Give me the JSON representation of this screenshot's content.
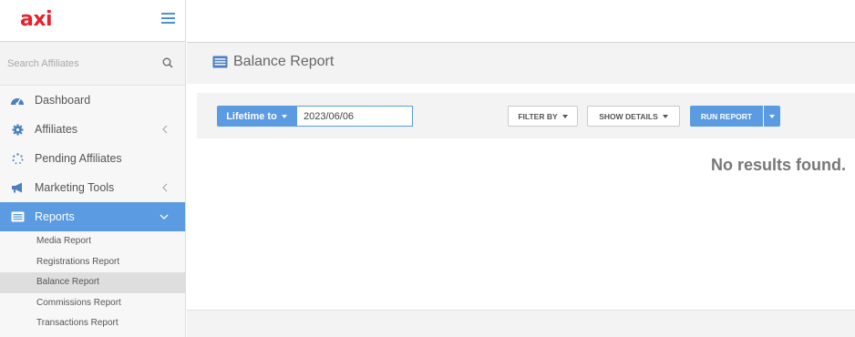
{
  "brand": {
    "logo_text": "axi",
    "logo_color": "#e8202a"
  },
  "sidebar": {
    "search_placeholder": "Search Affiliates",
    "items": [
      {
        "label": "Dashboard",
        "icon": "dashboard-gauge-icon"
      },
      {
        "label": "Affiliates",
        "icon": "gear-icon",
        "chevron": "left"
      },
      {
        "label": "Pending Affiliates",
        "icon": "spinner-dots-icon"
      },
      {
        "label": "Marketing Tools",
        "icon": "megaphone-icon",
        "chevron": "left"
      },
      {
        "label": "Reports",
        "icon": "report-list-icon",
        "chevron": "down",
        "active": true
      }
    ],
    "sub_items": [
      {
        "label": "Media Report"
      },
      {
        "label": "Registrations Report"
      },
      {
        "label": "Balance Report",
        "active": true
      },
      {
        "label": "Commissions Report"
      },
      {
        "label": "Transactions Report"
      }
    ]
  },
  "page": {
    "title": "Balance Report",
    "title_icon": "report-list-icon"
  },
  "toolbar": {
    "lifetime_label": "Lifetime to",
    "date_value": "2023/06/06",
    "filter_by_label": "FILTER BY",
    "show_details_label": "SHOW DETAILS",
    "run_report_label": "RUN REPORT"
  },
  "results": {
    "empty_message": "No results found."
  },
  "colors": {
    "accent": "#5a9be1",
    "sidebar_bg": "#f7f7f7",
    "header_bg": "#f3f3f3"
  }
}
